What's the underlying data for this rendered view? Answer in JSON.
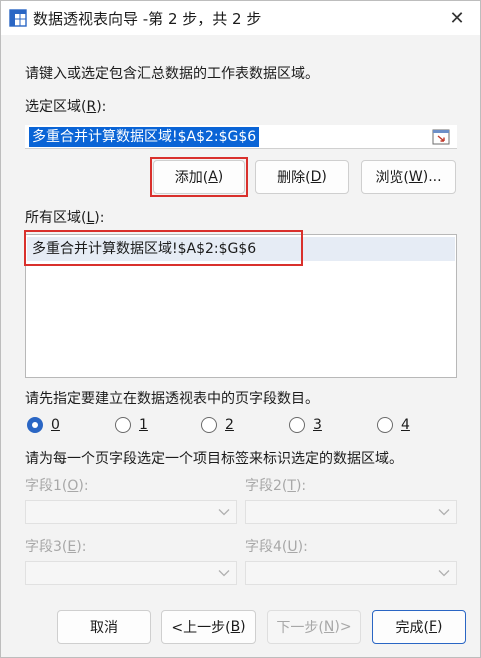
{
  "window": {
    "title": "数据透视表向导 -第 2 步，共 2 步",
    "close_glyph": "✕"
  },
  "instructions": {
    "top": "请键入或选定包含汇总数据的工作表数据区域。",
    "page_fields": "请先指定要建立在数据透视表中的页字段数目。",
    "item_labels": "请为每一个页字段选定一个项目标签来标识选定的数据区域。"
  },
  "selected_range": {
    "label": "选定区域(",
    "label_key": "R",
    "label_end": "):",
    "value": "多重合并计算数据区域!$A$2:$G$6"
  },
  "range_buttons": {
    "add": {
      "label": "添加(",
      "key": "A",
      "end": ")"
    },
    "delete": {
      "label": "删除(",
      "key": "D",
      "end": ")"
    },
    "browse": {
      "label": "浏览(",
      "key": "W",
      "end": ")..."
    }
  },
  "all_ranges": {
    "label": "所有区域(",
    "label_key": "L",
    "label_end": "):",
    "items": [
      "多重合并计算数据区域!$A$2:$G$6"
    ]
  },
  "page_field_count": {
    "options": [
      "0",
      "1",
      "2",
      "3",
      "4"
    ],
    "selected": "0"
  },
  "fields": [
    {
      "label": "字段1(",
      "key": "O",
      "end": "):",
      "value": ""
    },
    {
      "label": "字段2(",
      "key": "T",
      "end": "):",
      "value": ""
    },
    {
      "label": "字段3(",
      "key": "E",
      "end": "):",
      "value": ""
    },
    {
      "label": "字段4(",
      "key": "U",
      "end": "):",
      "value": ""
    }
  ],
  "footer_buttons": {
    "cancel": "取消",
    "back": {
      "label": "<上一步(",
      "key": "B",
      "end": ")"
    },
    "next": {
      "label": "下一步(",
      "key": "N",
      "end": ")>"
    },
    "finish": {
      "label": "完成(",
      "key": "F",
      "end": ")"
    }
  },
  "colors": {
    "accent": "#2a66c4",
    "selection": "#0a64d6",
    "highlight_box": "#d9302c",
    "list_selected_row": "#e6ecf5"
  }
}
